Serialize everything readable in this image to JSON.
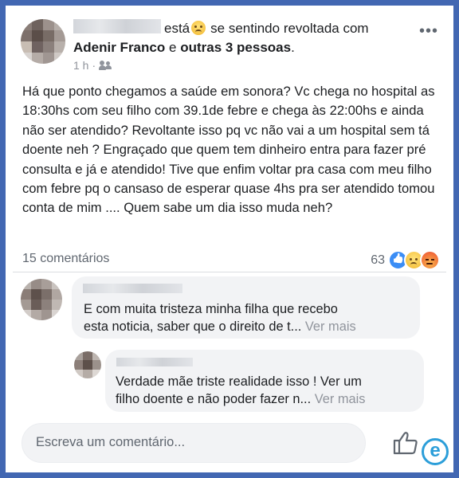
{
  "post": {
    "header": {
      "verb": "está",
      "feeling_text": "se sentindo revoltada com",
      "tagged_primary": "Adenir Franco",
      "connector": "e",
      "tagged_others": "outras 3 pessoas",
      "tail": "."
    },
    "meta": {
      "time": "1 h",
      "separator": "·",
      "privacy_icon": "friends-icon"
    },
    "body": "Há que ponto chegamos a saúde em sonora? Vc chega no hospital as 18:30hs com seu filho com 39.1de febre e chega às 22:00hs e ainda não ser atendido? Revoltante isso pq  vc não vai a um hospital sem tá doente neh ? Engraçado que quem tem dinheiro entra para fazer pré consulta e já e atendido! Tive que enfim voltar pra casa com meu filho com febre pq o cansaso de esperar quase 4hs pra ser atendido tomou conta de mim .... Quem sabe um dia isso muda neh?",
    "comments_count": "15 comentários",
    "reactions_count": "63",
    "reaction_icons": [
      "like-icon",
      "sad-icon",
      "angry-icon"
    ]
  },
  "comments": [
    {
      "text_line1": "E com muita tristeza minha filha que recebo",
      "text_line2": "esta noticia, saber que o direito de t...",
      "see_more": "Ver mais"
    },
    {
      "text_line1": "Verdade mãe  triste realidade isso ! Ver um",
      "text_line2": "filho doente e não poder fazer n...",
      "see_more": "Ver mais"
    }
  ],
  "composer": {
    "placeholder": "Escreva um comentário..."
  },
  "colors": {
    "frame": "#4267b2",
    "bubble": "#f2f3f5",
    "muted_text": "#90949c",
    "brand": "#2c9ed9"
  }
}
